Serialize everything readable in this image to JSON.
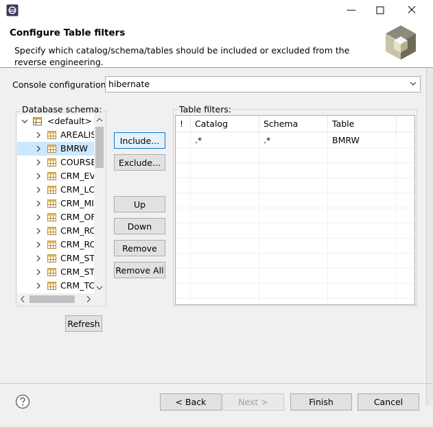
{
  "window": {
    "title": "",
    "controls": {
      "minimize": "—",
      "maximize": "",
      "close": ""
    }
  },
  "header": {
    "title": "Configure Table filters",
    "description": "Specify which catalog/schema/tables should be included or excluded from the reverse engineering."
  },
  "console": {
    "label": "Console configuration:",
    "value": "hibernate"
  },
  "schema": {
    "label": "Database schema:",
    "root": "<default>",
    "items": [
      {
        "label": "AREALIS"
      },
      {
        "label": "BMRW",
        "selected": true
      },
      {
        "label": "COURSE"
      },
      {
        "label": "CRM_EV"
      },
      {
        "label": "CRM_LC"
      },
      {
        "label": "CRM_MI"
      },
      {
        "label": "CRM_OF"
      },
      {
        "label": "CRM_RC"
      },
      {
        "label": "CRM_RC"
      },
      {
        "label": "CRM_ST"
      },
      {
        "label": "CRM_ST"
      },
      {
        "label": "CRM_TC"
      }
    ],
    "refresh_label": "Refresh"
  },
  "actions": {
    "include": "Include...",
    "exclude": "Exclude...",
    "up": "Up",
    "down": "Down",
    "remove": "Remove",
    "remove_all": "Remove All"
  },
  "filters": {
    "label": "Table filters:",
    "columns": [
      "!",
      "Catalog",
      "Schema",
      "Table"
    ],
    "rows": [
      {
        "flag": "",
        "catalog": ".*",
        "schema": ".*",
        "table": "BMRW"
      }
    ]
  },
  "footer": {
    "back": "< Back",
    "next": "Next >",
    "finish": "Finish",
    "cancel": "Cancel"
  },
  "colors": {
    "accent": "#0078d7",
    "selection": "#cce8ff",
    "dialog_bg": "#f0f0f0"
  },
  "icons": {
    "app": "eclipse-icon",
    "logo": "hibernate-cube-icon",
    "table": "table-icon",
    "schema": "schema-icon",
    "help": "help-icon"
  }
}
